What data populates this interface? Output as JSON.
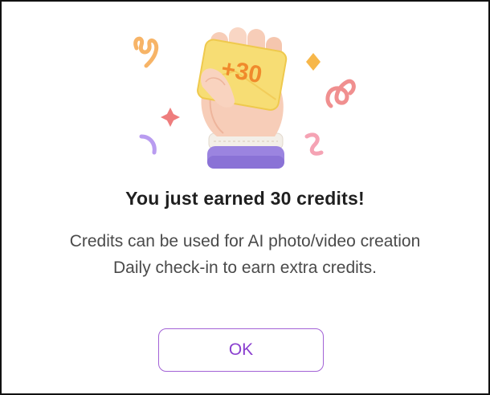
{
  "dialog": {
    "badge_text": "+30",
    "title": "You just earned 30 credits!",
    "body_lines": [
      "Credits can be used for AI photo/video creation",
      "Daily check-in to earn extra credits."
    ],
    "ok_label": "OK"
  },
  "colors": {
    "accent": "#8a3fcf",
    "button_border": "#a262d6",
    "card": "#f7dd74",
    "card_text": "#f08a2c",
    "cuff": "#9b84e0"
  },
  "icons": [
    "hand-holding-card-icon",
    "confetti-icon"
  ]
}
